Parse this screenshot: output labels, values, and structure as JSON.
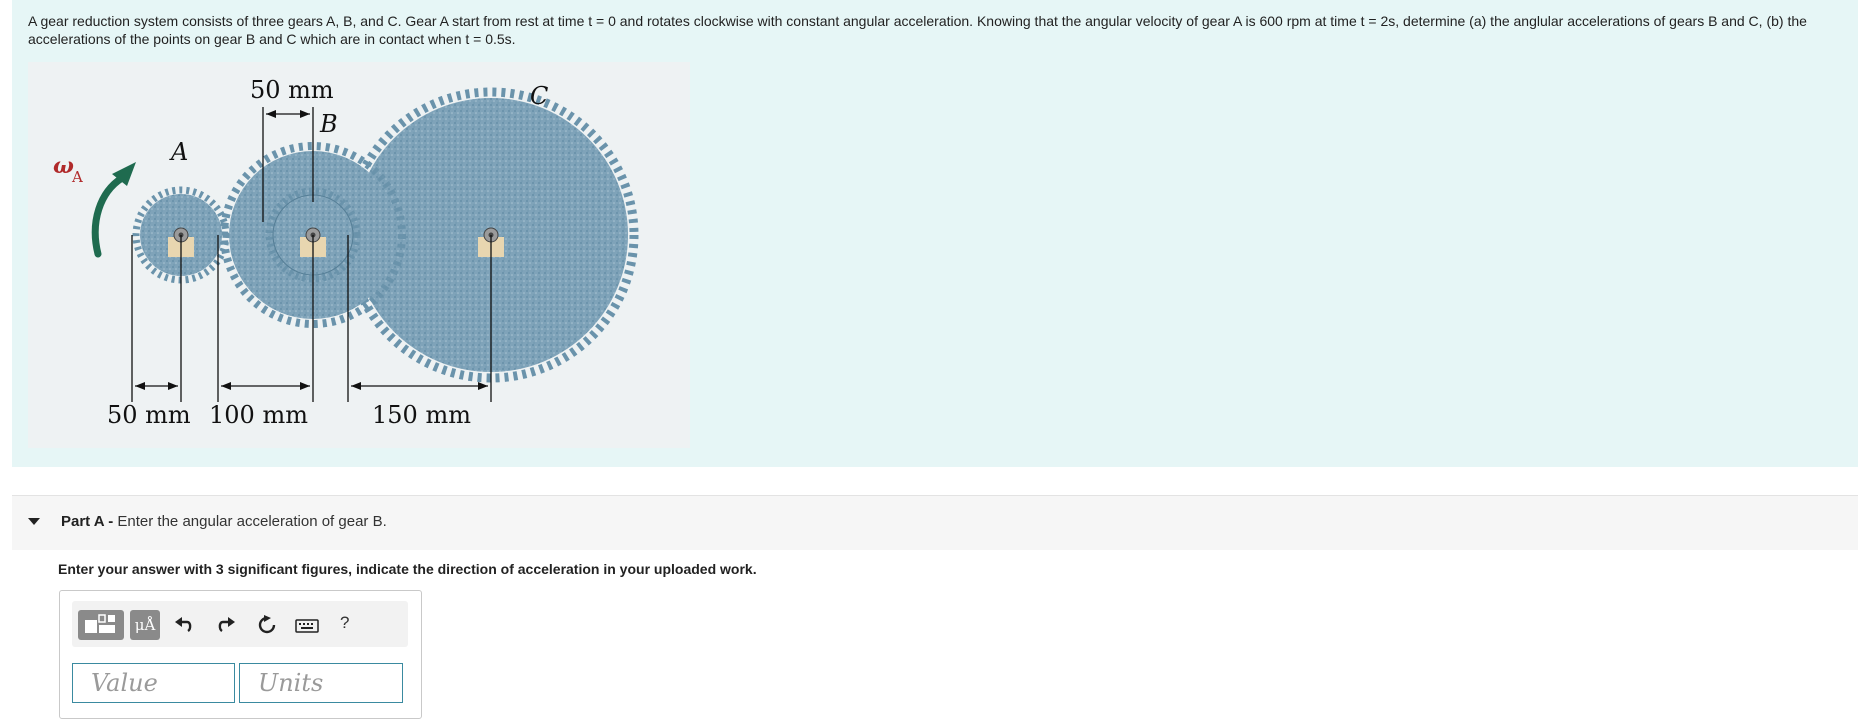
{
  "problem": {
    "text": "A gear reduction system consists of three gears A, B, and C. Gear A start from rest at time t = 0 and rotates clockwise with constant angular acceleration. Knowing that the angular velocity of gear A is 600 rpm at time t = 2s, determine (a) the anglular accelerations of gears B and C, (b) the accelerations of the points on gear B and C which are in contact when t = 0.5s."
  },
  "figure": {
    "label_omega": "ω",
    "label_omega_sub": "A",
    "label_a": "A",
    "label_b": "B",
    "label_c": "C",
    "dim_top": "50 mm",
    "dim_a": "50 mm",
    "dim_b": "100 mm",
    "dim_c": "150 mm",
    "colors": {
      "gear": "#7fa3b9",
      "arrow": "#1f6b4f"
    }
  },
  "part_a": {
    "label": "Part A -",
    "title": "Enter the angular acceleration of gear B.",
    "instructions": "Enter your answer with 3 significant figures, indicate the direction of acceleration in your uploaded work."
  },
  "toolbar": {
    "templates_icon": "templates-icon",
    "units_label": "μÅ",
    "undo_icon": "undo-icon",
    "redo_icon": "redo-icon",
    "reset_icon": "reset-icon",
    "keyboard_icon": "keyboard-icon",
    "help_label": "?"
  },
  "inputs": {
    "value_placeholder": "Value",
    "units_placeholder": "Units"
  }
}
